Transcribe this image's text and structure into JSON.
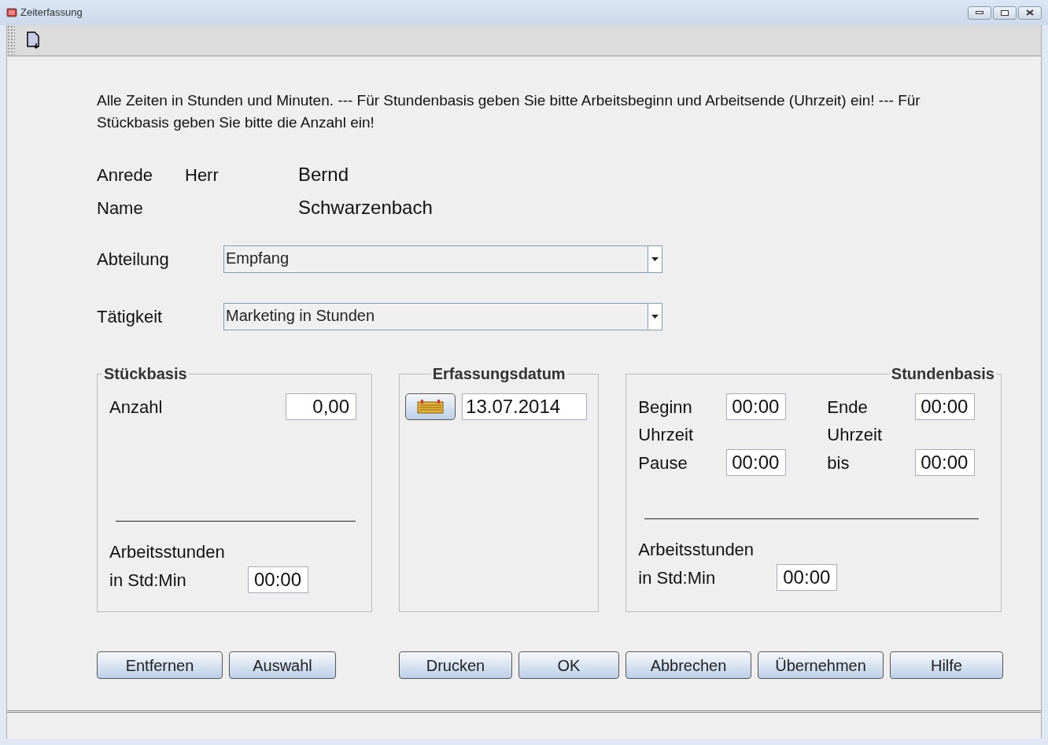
{
  "window": {
    "title": "Zeiterfassung"
  },
  "instructions": "Alle Zeiten in Stunden und Minuten. --- Für Stundenbasis geben Sie bitte Arbeitsbeginn und Arbeitsende (Uhrzeit) ein!  --- Für Stückbasis geben Sie bitte die Anzahl ein!",
  "person": {
    "salutation_label": "Anrede",
    "salutation": "Herr",
    "first_name": "Bernd",
    "name_label": "Name",
    "last_name": "Schwarzenbach"
  },
  "selects": [
    {
      "label": "Abteilung",
      "value": "Empfang"
    },
    {
      "label": "Tätigkeit",
      "value": "Marketing in Stunden"
    }
  ],
  "stueckbasis": {
    "title": "Stückbasis",
    "count_label": "Anzahl",
    "count": "0,00",
    "hours_label_1": "Arbeitsstunden",
    "hours_label_2": "in Std:Min",
    "hours": "00:00"
  },
  "erfassungsdatum": {
    "title": "Erfassungsdatum",
    "date": "13.07.2014"
  },
  "stundenbasis": {
    "title": "Stundenbasis",
    "begin_label": "Beginn",
    "begin": "00:00",
    "end_label": "Ende",
    "end": "00:00",
    "uhrzeit_left": "Uhrzeit",
    "uhrzeit_right": "Uhrzeit",
    "pause_label": "Pause",
    "pause": "00:00",
    "bis_label": "bis",
    "bis": "00:00",
    "hours_label_1": "Arbeitsstunden",
    "hours_label_2": "in Std:Min",
    "hours": "00:00"
  },
  "buttons_left": [
    {
      "label": "Entfernen"
    },
    {
      "label": "Auswahl"
    }
  ],
  "buttons_right": [
    {
      "label": "Drucken"
    },
    {
      "label": "OK"
    },
    {
      "label": "Abbrechen"
    },
    {
      "label": "Übernehmen"
    },
    {
      "label": "Hilfe"
    }
  ]
}
